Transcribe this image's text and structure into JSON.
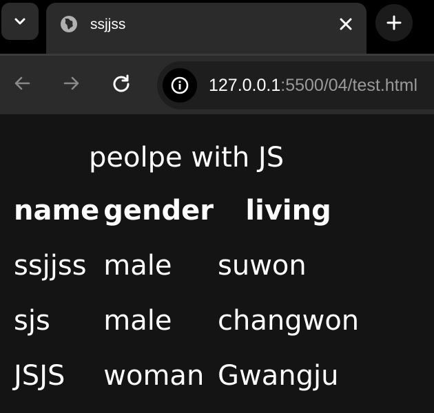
{
  "browser": {
    "tab": {
      "title": "ssjjss"
    },
    "address_bar": {
      "url_host": "127.0.0.1",
      "url_rest": ":5500/04/test.html"
    }
  },
  "page": {
    "table_caption": "peolpe with JS",
    "columns": [
      "name",
      "gender",
      "living"
    ],
    "rows": [
      [
        "ssjjss",
        "male",
        "suwon"
      ],
      [
        "sjs",
        "male",
        "changwon"
      ],
      [
        "JSJS",
        "woman",
        "Gwangju"
      ]
    ]
  }
}
